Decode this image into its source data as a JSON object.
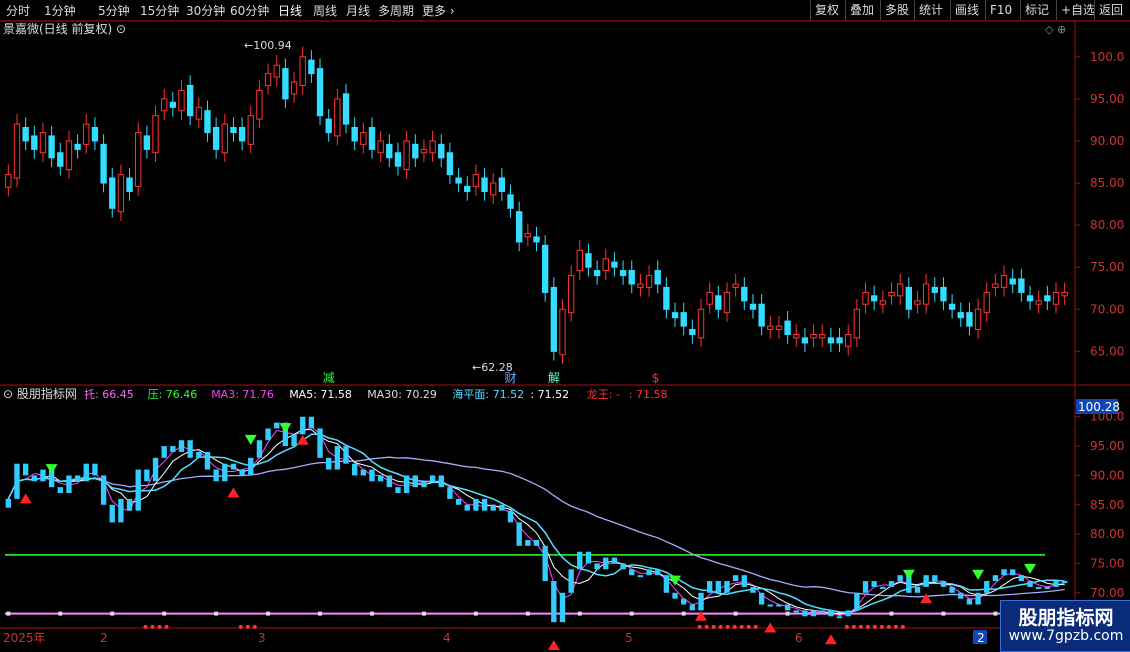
{
  "toolbar": {
    "periods": [
      "分时",
      "1分钟",
      "5分钟",
      "15分钟",
      "30分钟",
      "60分钟",
      "日线",
      "周线",
      "月线",
      "多周期",
      "更多"
    ],
    "active": "日线",
    "right_buttons": [
      "复权",
      "叠加",
      "多股",
      "统计",
      "画线",
      "F10",
      "标记",
      "+自选",
      "返回"
    ]
  },
  "main_panel": {
    "title": "景嘉微(日线 前复权)",
    "high_label": "100.94",
    "low_label": "62.28",
    "price_axis": [
      "100.0",
      "95.00",
      "90.00",
      "85.00",
      "80.00",
      "75.00",
      "70.00",
      "65.00"
    ],
    "event_marks": [
      {
        "text": "减",
        "color": "#33ff33",
        "day": 37
      },
      {
        "text": "财",
        "color": "#66aaff",
        "day": 58
      },
      {
        "text": "解",
        "color": "#66ffcc",
        "day": 63
      },
      {
        "text": "$",
        "color": "#ff3333",
        "day": 75
      }
    ]
  },
  "indicator_panel": {
    "name": "股朋指标网",
    "legend": [
      {
        "text": "托: 66.45",
        "color": "#ff66ff"
      },
      {
        "text": "压: 76.46",
        "color": "#33ff33"
      },
      {
        "text": "MA3: 71.76",
        "color": "#ff44ff"
      },
      {
        "text": "MA5: 71.58",
        "color": "#ffffff"
      },
      {
        "text": "MA30: 70.29",
        "color": "#dddddd"
      },
      {
        "text": "海平面: 71.52",
        "color": "#55ddff"
      },
      {
        "text": ": 71.52",
        "color": "#ffffff"
      },
      {
        "text": "龙王: -",
        "color": "#ff3333"
      },
      {
        "text": ": 71.58",
        "color": "#ff3333"
      }
    ],
    "current_value": "100.28",
    "axis": [
      "100.0",
      "95.00",
      "90.00",
      "85.00",
      "80.00",
      "75.00",
      "70.00"
    ],
    "support": 66.45,
    "resistance": 76.46
  },
  "time_axis": [
    "2025年",
    "2",
    "3",
    "4",
    "5",
    "6",
    "2"
  ],
  "logo": {
    "title": "股朋指标网",
    "url": "www.7gpzb.com"
  },
  "colors": {
    "up": "#ff3333",
    "down": "#33ddff",
    "support": "#ff88ff",
    "resistance": "#33ff33",
    "frame": "#a01010"
  },
  "chart_data": {
    "type": "candlestick",
    "title": "景嘉微(日线 前复权)",
    "ylim": [
      61,
      102
    ],
    "closes": [
      86,
      92,
      90,
      89,
      91,
      88,
      87,
      90,
      89,
      92,
      90,
      85,
      82,
      86,
      84,
      91,
      89,
      93,
      95,
      94,
      96,
      93,
      94,
      91,
      89,
      92,
      91,
      90,
      93,
      96,
      98,
      99,
      95,
      97,
      100,
      98,
      93,
      91,
      95,
      92,
      90,
      91,
      89,
      90,
      88,
      87,
      90,
      88,
      89,
      90,
      88,
      86,
      85,
      84,
      86,
      84,
      85,
      84,
      82,
      78,
      79,
      78,
      72,
      65,
      70,
      74,
      77,
      75,
      74,
      76,
      75,
      74,
      73,
      73,
      74,
      73,
      70,
      69,
      68,
      67,
      70,
      72,
      70,
      72,
      73,
      71,
      70,
      68,
      68,
      68,
      67,
      67,
      66,
      67,
      67,
      66,
      66,
      67,
      70,
      72,
      71,
      71,
      72,
      73,
      70,
      71,
      73,
      72,
      71,
      70,
      69,
      68,
      70,
      72,
      73,
      74,
      73,
      72,
      71,
      71,
      71,
      72,
      72
    ]
  }
}
